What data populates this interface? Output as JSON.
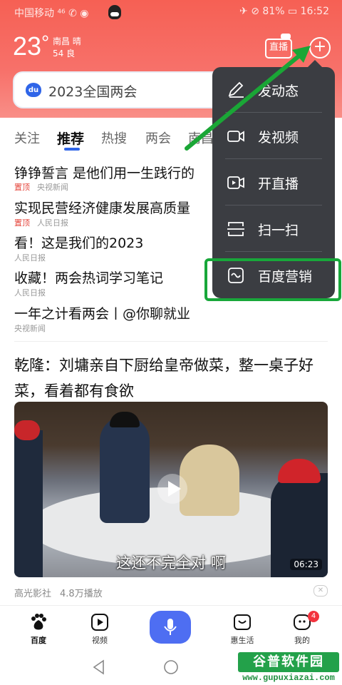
{
  "statusbar": {
    "carrier": "中国移动 ⁴⁶ ✆ ◉",
    "right": "✈ ⊘ 81% ▭ 16:52"
  },
  "weather": {
    "temp": "23",
    "deg": "°",
    "city": "南昌 晴",
    "aqi": "54 良"
  },
  "header": {
    "live_label": "直播"
  },
  "search": {
    "placeholder": "2023全国两会"
  },
  "tabs": [
    "关注",
    "推荐",
    "热搜",
    "两会",
    "南昌"
  ],
  "news": [
    {
      "title": "铮铮誓言 是他们用一生践行的",
      "pinned": "置顶",
      "source": "央视新闻"
    },
    {
      "title": "实现民营经济健康发展高质量",
      "pinned": "置顶",
      "source": "人民日报"
    },
    {
      "title": "看！这是我们的2023",
      "pinned": "",
      "source": "人民日报"
    },
    {
      "title": "收藏！两会热词学习笔记",
      "pinned": "",
      "source": "人民日报"
    },
    {
      "title": "一年之计看两会丨@你聊就业",
      "pinned": "",
      "source": "央视新闻"
    }
  ],
  "feature": {
    "title": "乾隆：刘墉亲自下厨给皇帝做菜，整一桌子好菜，看着都有食欲",
    "subtitle": "这还不完全对 啊",
    "duration": "06:23",
    "source": "高光影社",
    "plays": "4.8万播放"
  },
  "bottom_nav": [
    {
      "label": "百度"
    },
    {
      "label": "视频"
    },
    {
      "label": ""
    },
    {
      "label": "惠生活"
    },
    {
      "label": "我的"
    }
  ],
  "badge_count": "4",
  "menu": [
    {
      "label": "发动态"
    },
    {
      "label": "发视频"
    },
    {
      "label": "开直播"
    },
    {
      "label": "扫一扫"
    },
    {
      "label": "百度营销"
    }
  ],
  "watermark": {
    "title": "谷普软件园",
    "url": "www.gupuxiazai.com"
  },
  "colors": {
    "accent": "#2f65e8",
    "header": "#f66054",
    "highlight": "#18a73a",
    "menu_bg": "#3b3d42"
  }
}
